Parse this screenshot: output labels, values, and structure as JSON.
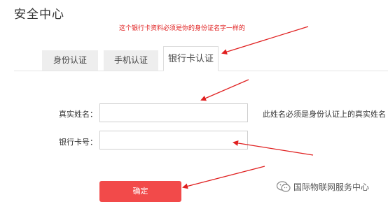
{
  "page": {
    "title": "安全中心",
    "annotation_top": "这个银行卡资料必须是你的身份证名字一样的"
  },
  "tabs": [
    {
      "label": "身份认证",
      "active": false
    },
    {
      "label": "手机认证",
      "active": false
    },
    {
      "label": "银行卡认证",
      "active": true
    }
  ],
  "form": {
    "name_label": "真实姓名：",
    "name_value": "",
    "name_hint": "此姓名必须是身份认证上的真实姓名",
    "card_label": "银行卡号：",
    "card_value": "",
    "submit_label": "确定"
  },
  "watermark": {
    "text": "国际物联网服务中心",
    "icon": "wechat-icon"
  },
  "colors": {
    "accent": "#f24a4a",
    "annotation": "#e02020",
    "tab_bg": "#eeeeee"
  }
}
